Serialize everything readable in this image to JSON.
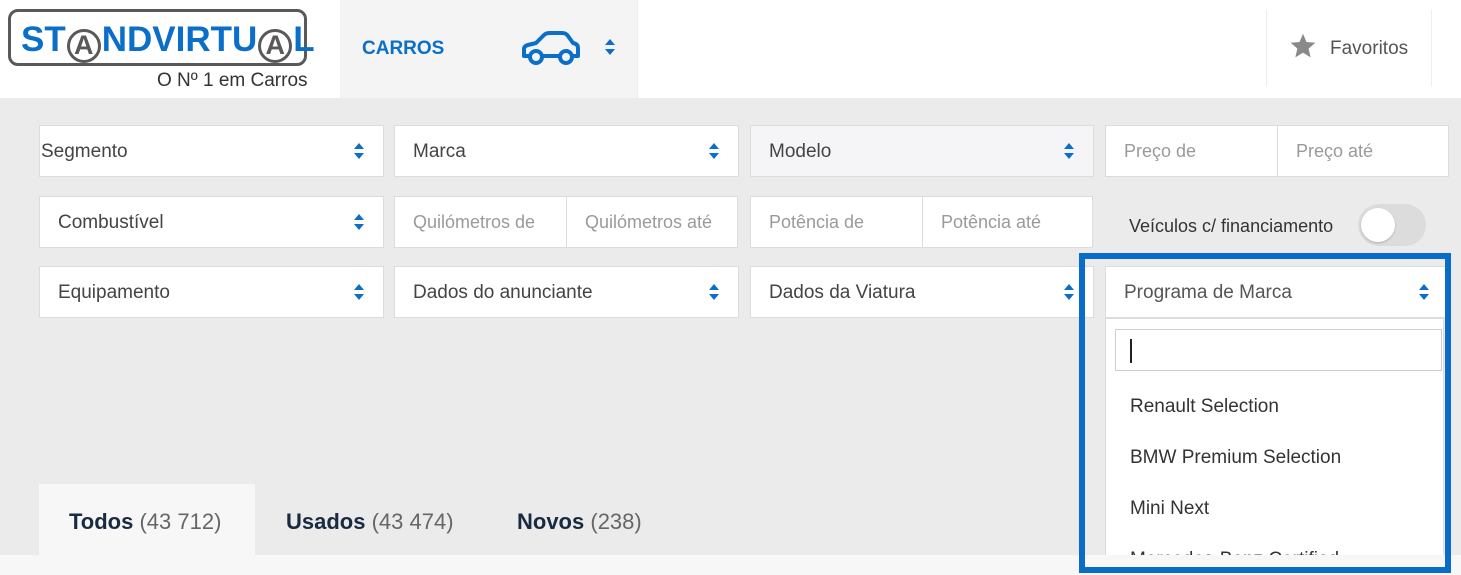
{
  "header": {
    "logo": {
      "text_part1": "ST",
      "ring_letter": "A",
      "text_part2": "NDVIRTU",
      "ring_letter2": "A",
      "text_part3": "L",
      "tagline": "O Nº 1 em Carros"
    },
    "category": {
      "label": "CARROS",
      "icon": "car-icon"
    },
    "favorites": {
      "label": "Favoritos",
      "icon": "star-icon"
    }
  },
  "filters": {
    "segmento": "Segmento",
    "marca": "Marca",
    "modelo": "Modelo",
    "preco_de": "Preço de",
    "preco_ate": "Preço até",
    "combustivel": "Combustível",
    "km_de": "Quilómetros de",
    "km_ate": "Quilómetros até",
    "potencia_de": "Potência de",
    "potencia_ate": "Potência até",
    "financiamento_label": "Veículos c/ financiamento",
    "equipamento": "Equipamento",
    "dados_anunciante": "Dados do anunciante",
    "dados_viatura": "Dados da Viatura",
    "programa_marca": "Programa de Marca"
  },
  "dropdown": {
    "search_value": "",
    "options": [
      "Renault Selection",
      "BMW Premium Selection",
      "Mini Next",
      "Mercedes-Benz Certified"
    ]
  },
  "tabs": [
    {
      "label": "Todos",
      "count": "(43 712)"
    },
    {
      "label": "Usados",
      "count": "(43 474)"
    },
    {
      "label": "Novos",
      "count": "(238)"
    }
  ],
  "colors": {
    "accent": "#0b6fc9",
    "highlight": "#0a6cc9"
  }
}
